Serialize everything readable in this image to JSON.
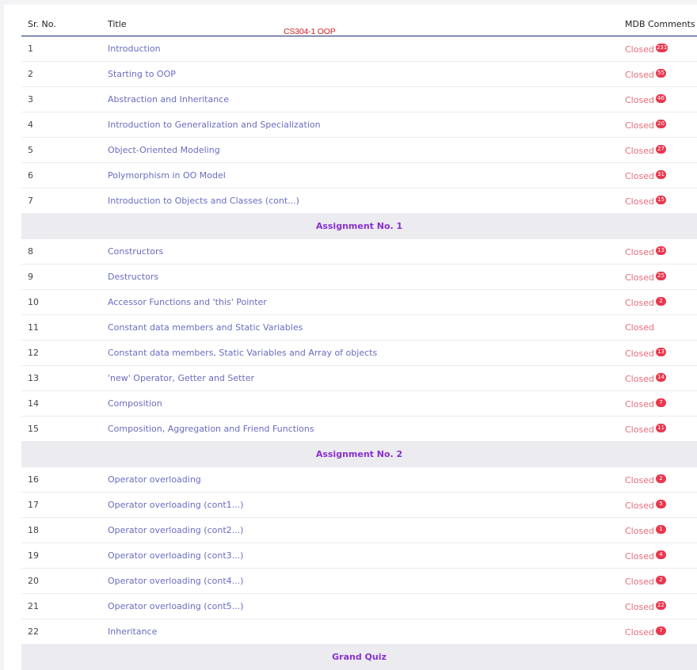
{
  "watermark": "CS304-1 OOP",
  "headers": {
    "sr": "Sr. No.",
    "title": "Title",
    "comments": "MDB Comments"
  },
  "rows": [
    {
      "type": "row",
      "sr": "1",
      "title": "Introduction",
      "status": "Closed",
      "badge": "231"
    },
    {
      "type": "row",
      "sr": "2",
      "title": "Starting to OOP",
      "status": "Closed",
      "badge": "55"
    },
    {
      "type": "row",
      "sr": "3",
      "title": "Abstraction and Inheritance",
      "status": "Closed",
      "badge": "46"
    },
    {
      "type": "row",
      "sr": "4",
      "title": "Introduction to Generalization and Specialization",
      "status": "Closed",
      "badge": "20"
    },
    {
      "type": "row",
      "sr": "5",
      "title": "Object-Oriented Modeling",
      "status": "Closed",
      "badge": "27"
    },
    {
      "type": "row",
      "sr": "6",
      "title": "Polymorphism in OO Model",
      "status": "Closed",
      "badge": "31"
    },
    {
      "type": "row",
      "sr": "7",
      "title": "Introduction to Objects and Classes (cont...)",
      "status": "Closed",
      "badge": "15"
    },
    {
      "type": "section",
      "label": "Assignment No. 1"
    },
    {
      "type": "row",
      "sr": "8",
      "title": "Constructors",
      "status": "Closed",
      "badge": "13"
    },
    {
      "type": "row",
      "sr": "9",
      "title": "Destructors",
      "status": "Closed",
      "badge": "25"
    },
    {
      "type": "row",
      "sr": "10",
      "title": "Accessor Functions and 'this' Pointer",
      "status": "Closed",
      "badge": "2"
    },
    {
      "type": "row",
      "sr": "11",
      "title": "Constant data members and Static Variables",
      "status": "Closed",
      "badge": ""
    },
    {
      "type": "row",
      "sr": "12",
      "title": "Constant data members, Static Variables and Array of objects",
      "status": "Closed",
      "badge": "13"
    },
    {
      "type": "row",
      "sr": "13",
      "title": "'new' Operator, Getter and Setter",
      "status": "Closed",
      "badge": "14"
    },
    {
      "type": "row",
      "sr": "14",
      "title": "Composition",
      "status": "Closed",
      "badge": "7"
    },
    {
      "type": "row",
      "sr": "15",
      "title": "Composition, Aggregation and Friend Functions",
      "status": "Closed",
      "badge": "11"
    },
    {
      "type": "section",
      "label": "Assignment No. 2"
    },
    {
      "type": "row",
      "sr": "16",
      "title": "Operator overloading",
      "status": "Closed",
      "badge": "2"
    },
    {
      "type": "row",
      "sr": "17",
      "title": "Operator overloading (cont1...)",
      "status": "Closed",
      "badge": "5"
    },
    {
      "type": "row",
      "sr": "18",
      "title": "Operator overloading (cont2...)",
      "status": "Closed",
      "badge": "1"
    },
    {
      "type": "row",
      "sr": "19",
      "title": "Operator overloading (cont3...)",
      "status": "Closed",
      "badge": "4"
    },
    {
      "type": "row",
      "sr": "20",
      "title": "Operator overloading (cont4...)",
      "status": "Closed",
      "badge": "2"
    },
    {
      "type": "row",
      "sr": "21",
      "title": "Operator overloading (cont5...)",
      "status": "Closed",
      "badge": "22"
    },
    {
      "type": "row",
      "sr": "22",
      "title": "Inheritance",
      "status": "Closed",
      "badge": "7"
    },
    {
      "type": "section",
      "label": "Grand Quiz"
    }
  ]
}
